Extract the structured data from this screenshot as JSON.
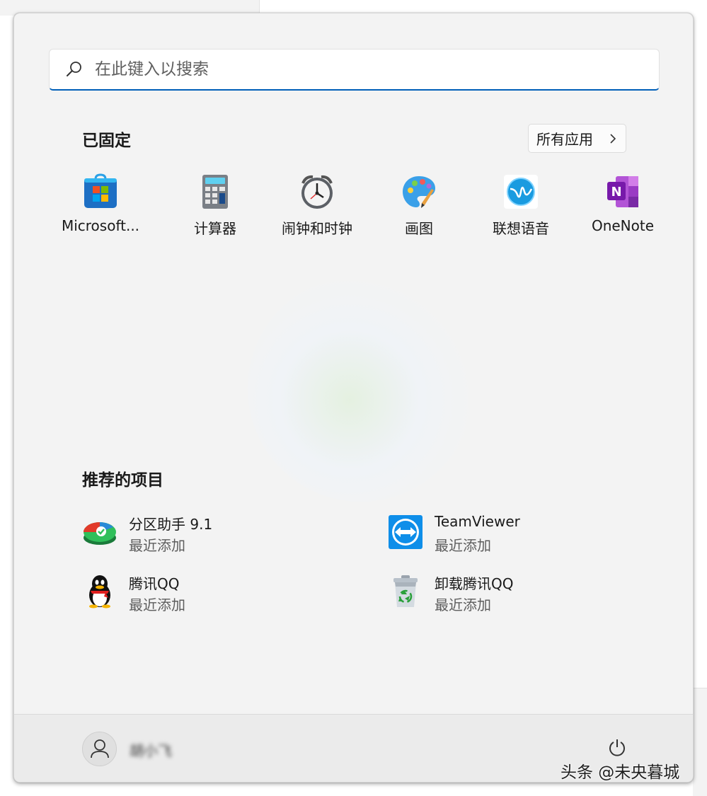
{
  "search": {
    "placeholder": "在此键入以搜索"
  },
  "pinned": {
    "title": "已固定",
    "all_apps_label": "所有应用",
    "apps": [
      {
        "label": "Microsoft...",
        "icon": "microsoft-store-icon"
      },
      {
        "label": "计算器",
        "icon": "calculator-icon"
      },
      {
        "label": "闹钟和时钟",
        "icon": "alarm-clock-icon"
      },
      {
        "label": "画图",
        "icon": "paint-palette-icon"
      },
      {
        "label": "联想语音",
        "icon": "lenovo-voice-icon"
      },
      {
        "label": "OneNote",
        "icon": "onenote-icon"
      }
    ]
  },
  "recommended": {
    "title": "推荐的项目",
    "items": [
      {
        "name": "分区助手 9.1",
        "sub": "最近添加",
        "icon": "partition-assistant-icon"
      },
      {
        "name": "TeamViewer",
        "sub": "最近添加",
        "icon": "teamviewer-icon"
      },
      {
        "name": "腾讯QQ",
        "sub": "最近添加",
        "icon": "qq-penguin-icon"
      },
      {
        "name": "卸载腾讯QQ",
        "sub": "最近添加",
        "icon": "recycle-bin-icon"
      }
    ]
  },
  "footer": {
    "user_name": "胡小飞"
  },
  "watermark": "头条 @未央暮城",
  "colors": {
    "accent": "#005fb8",
    "panel_bg": "#f3f3f3",
    "footer_bg": "#ebebeb"
  }
}
